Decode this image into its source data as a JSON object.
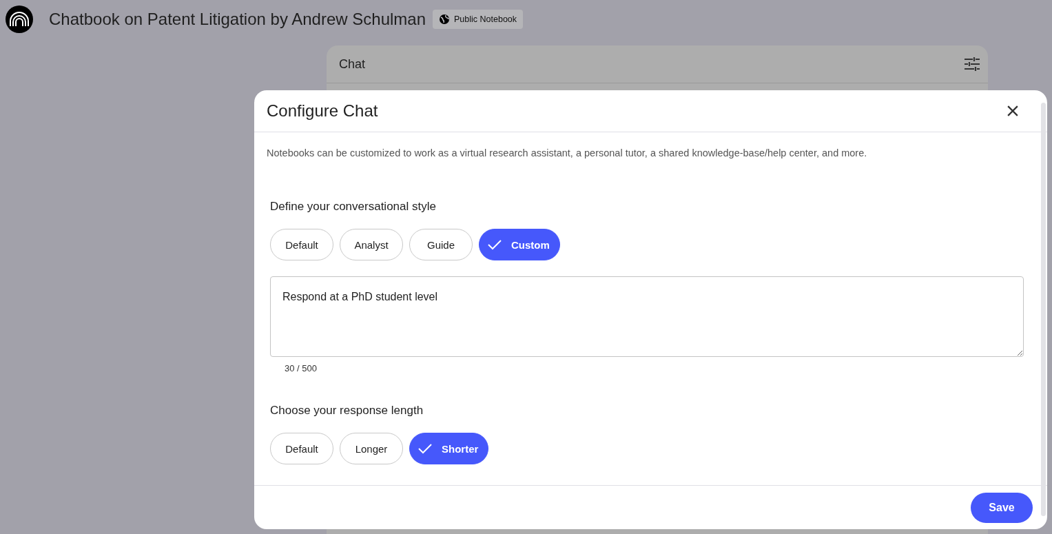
{
  "header": {
    "title": "Chatbook on Patent Litigation by Andrew Schulman",
    "badge": "Public Notebook"
  },
  "chat_panel": {
    "title": "Chat"
  },
  "dialog": {
    "title": "Configure Chat",
    "description": "Notebooks can be customized to work as a virtual research assistant, a personal tutor, a shared knowledge-base/help center, and more.",
    "style_section": {
      "heading": "Define your conversational style",
      "options": [
        {
          "label": "Default",
          "selected": false
        },
        {
          "label": "Analyst",
          "selected": false
        },
        {
          "label": "Guide",
          "selected": false
        },
        {
          "label": "Custom",
          "selected": true
        }
      ]
    },
    "custom_prompt": {
      "value": "Respond at a PhD student level",
      "counter": "30 / 500"
    },
    "length_section": {
      "heading": "Choose your response length",
      "options": [
        {
          "label": "Default",
          "selected": false
        },
        {
          "label": "Longer",
          "selected": false
        },
        {
          "label": "Shorter",
          "selected": true
        }
      ]
    },
    "save_button": "Save"
  }
}
